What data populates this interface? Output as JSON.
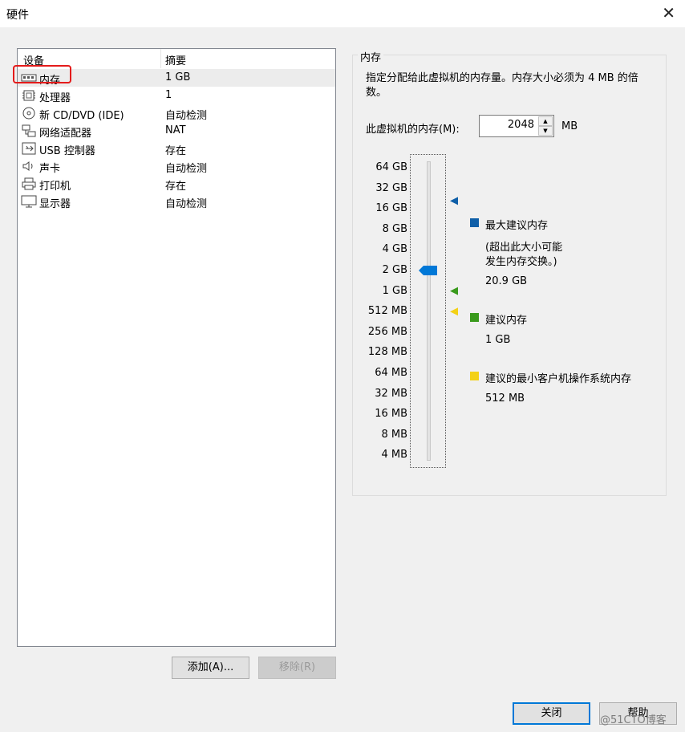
{
  "window": {
    "title": "硬件"
  },
  "device_list": {
    "col_device": "设备",
    "col_summary": "摘要",
    "rows": [
      {
        "name": "内存",
        "summary": "1 GB",
        "icon": "memory-icon",
        "selected": true
      },
      {
        "name": "处理器",
        "summary": "1",
        "icon": "cpu-icon"
      },
      {
        "name": "新 CD/DVD (IDE)",
        "summary": "自动检测",
        "icon": "cd-dvd-icon"
      },
      {
        "name": "网络适配器",
        "summary": "NAT",
        "icon": "network-icon"
      },
      {
        "name": "USB 控制器",
        "summary": "存在",
        "icon": "usb-icon"
      },
      {
        "name": "声卡",
        "summary": "自动检测",
        "icon": "speaker-icon"
      },
      {
        "name": "打印机",
        "summary": "存在",
        "icon": "printer-icon"
      },
      {
        "name": "显示器",
        "summary": "自动检测",
        "icon": "monitor-icon"
      }
    ]
  },
  "buttons": {
    "add": "添加(A)...",
    "remove": "移除(R)",
    "close": "关闭",
    "help": "帮助"
  },
  "memory": {
    "group_title": "内存",
    "description": "指定分配给此虚拟机的内存量。内存大小必须为 4 MB 的倍数。",
    "field_label": "此虚拟机的内存(M):",
    "value": "2048",
    "unit": "MB",
    "scale": [
      "64 GB",
      "32 GB",
      "16 GB",
      "8 GB",
      "4 GB",
      "2 GB",
      "1 GB",
      "512 MB",
      "256 MB",
      "128 MB",
      "64 MB",
      "32 MB",
      "16 MB",
      "8 MB",
      "4 MB"
    ],
    "slider_value_mb": 2048,
    "max_recommended": {
      "label": "最大建议内存",
      "note_line1": "(超出此大小可能",
      "note_line2": "发生内存交换。)",
      "value": "20.9 GB",
      "color": "#0f5fa8"
    },
    "recommended": {
      "label": "建议内存",
      "value": "1 GB",
      "color": "#3a9a1c"
    },
    "min_guest": {
      "label": "建议的最小客户机操作系统内存",
      "value": "512 MB",
      "color": "#f3d116"
    }
  },
  "watermark": "@51CTO博客"
}
